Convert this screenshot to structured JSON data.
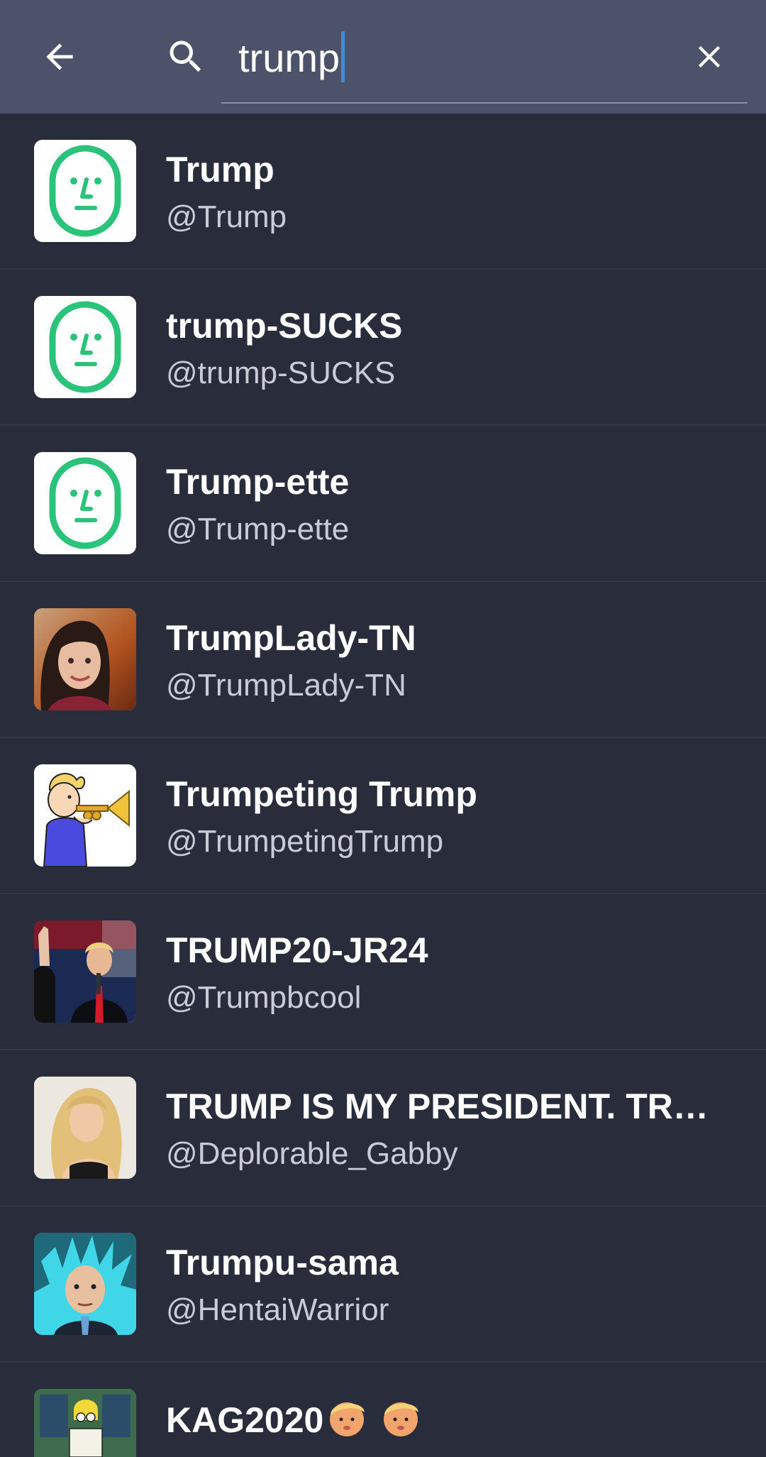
{
  "search": {
    "query": "trump"
  },
  "results": [
    {
      "name": "Trump",
      "handle": "@Trump",
      "avatar": "default-face-avatar"
    },
    {
      "name": "trump-SUCKS",
      "handle": "@trump-SUCKS",
      "avatar": "default-face-avatar"
    },
    {
      "name": "Trump-ette",
      "handle": "@Trump-ette",
      "avatar": "default-face-avatar"
    },
    {
      "name": "TrumpLady-TN",
      "handle": "@TrumpLady-TN",
      "avatar": "woman-photo-avatar"
    },
    {
      "name": "Trumpeting Trump",
      "handle": "@TrumpetingTrump",
      "avatar": "trumpet-player-cartoon-avatar"
    },
    {
      "name": "TRUMP20-JR24",
      "handle": "@Trumpbcool",
      "avatar": "man-at-podium-photo-avatar"
    },
    {
      "name": "TRUMP IS MY PRESIDENT. TRUMP",
      "handle": "@Deplorable_Gabby",
      "avatar": "blonde-woman-photo-avatar"
    },
    {
      "name": "Trumpu-sama",
      "handle": "@HentaiWarrior",
      "avatar": "anime-hair-man-avatar"
    },
    {
      "name": "KAG2020",
      "handle": "",
      "avatar": "cartoon-sign-avatar"
    }
  ],
  "colors": {
    "topbar": "#4c5269",
    "background": "#282c3b",
    "accent_green": "#2bc27a",
    "caret": "#3d8bdc"
  }
}
